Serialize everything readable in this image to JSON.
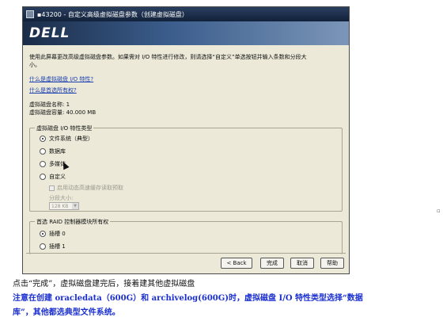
{
  "window": {
    "title": "▪43200 - 自定义高级虚拟磁盘参数（创建虚拟磁盘）",
    "logo": "DELL"
  },
  "intro": {
    "line1": "使用此屏幕更改高级虚拟磁盘参数。如果需对 I/O 特性进行修改，则请选择“自定义”单选按钮并输入条数和分段大",
    "line2": "小。"
  },
  "links": {
    "what_is_io": "什么是虚拟磁盘 I/O 特性?",
    "what_is_segment": "什么是首选所有权?"
  },
  "disk": {
    "name_line": "虚拟磁盘名称: 1",
    "capacity_line": "虚拟磁盘容量: 40.000 MB"
  },
  "io_group": {
    "title": "虚拟磁盘 I/O 特性类型",
    "options": [
      {
        "label": "文件系统（典型）",
        "selected": true
      },
      {
        "label": "数据库",
        "selected": false
      },
      {
        "label": "多媒体",
        "selected": false
      },
      {
        "label": "自定义",
        "selected": false
      }
    ],
    "cache_prefetch": "启用动态高速缓存读取预取",
    "segment_label": "分段大小:",
    "segment_value": "128 KB"
  },
  "ownership_group": {
    "title": "首选 RAID 控制器模块所有权",
    "options": [
      {
        "label": "插槽 0",
        "selected": true
      },
      {
        "label": "插槽 1",
        "selected": false
      }
    ]
  },
  "buttons": {
    "back": "< Back",
    "finish": "完成",
    "cancel": "取消",
    "help": "帮助"
  },
  "caption": "点击“完成”，虚拟磁盘建完后，接着建其他虚拟磁盘",
  "note": {
    "line1": "注意在创建 oracledata（600G）和 archivelog(600G)时，虚拟磁盘 I/O 特性类型选择“数据",
    "line2": "库”，其他都选典型文件系统。"
  }
}
